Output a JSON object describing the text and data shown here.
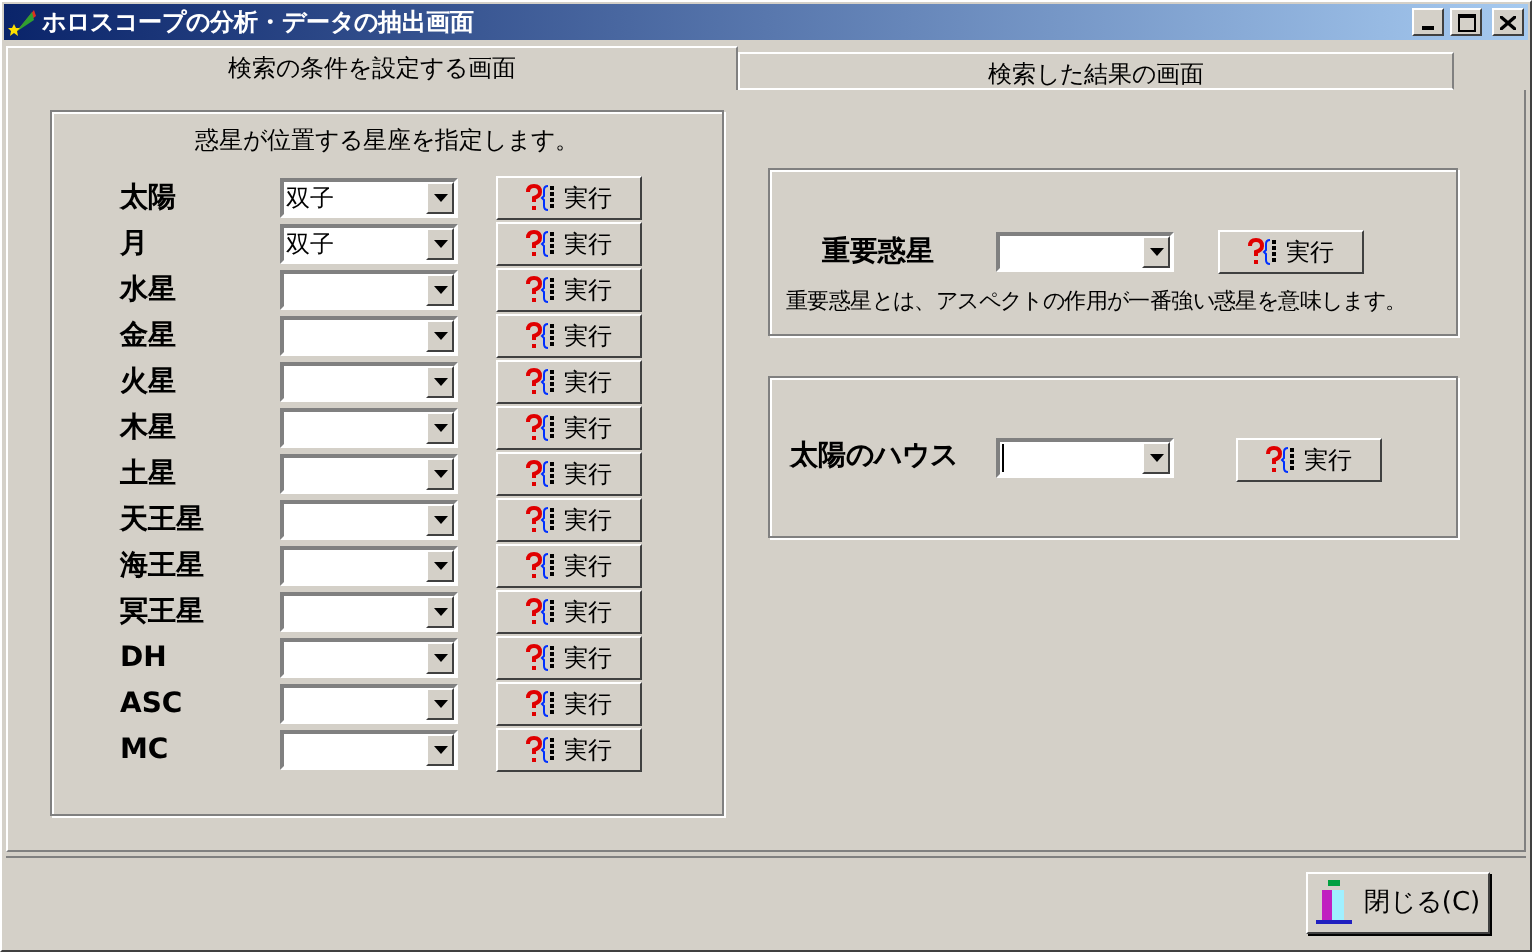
{
  "window": {
    "title": "ホロスコープの分析・データの抽出画面"
  },
  "tabs": [
    {
      "label": "検索の条件を設定する画面",
      "selected": true
    },
    {
      "label": "検索した結果の画面",
      "selected": false
    }
  ],
  "sign_panel": {
    "caption": "惑星が位置する星座を指定します。",
    "rows": [
      {
        "planet": "太陽",
        "value": "双子",
        "button": "実行"
      },
      {
        "planet": "月",
        "value": "双子",
        "button": "実行"
      },
      {
        "planet": "水星",
        "button": "実行"
      },
      {
        "planet": "金星",
        "button": "実行"
      },
      {
        "planet": "火星",
        "button": "実行"
      },
      {
        "planet": "木星",
        "button": "実行"
      },
      {
        "planet": "土星",
        "button": "実行"
      },
      {
        "planet": "天王星",
        "button": "実行"
      },
      {
        "planet": "海王星",
        "button": "実行"
      },
      {
        "planet": "冥王星",
        "button": "実行"
      },
      {
        "planet": "DH",
        "button": "実行"
      },
      {
        "planet": "ASC",
        "button": "実行"
      },
      {
        "planet": "MC",
        "button": "実行"
      }
    ]
  },
  "important_planet": {
    "label": "重要惑星",
    "button": "実行",
    "note": "重要惑星とは、アスペクトの作用が一番強い惑星を意味します。"
  },
  "sun_house": {
    "label": "太陽のハウス",
    "button": "実行",
    "focused": true
  },
  "close_button": "閉じる(C)"
}
